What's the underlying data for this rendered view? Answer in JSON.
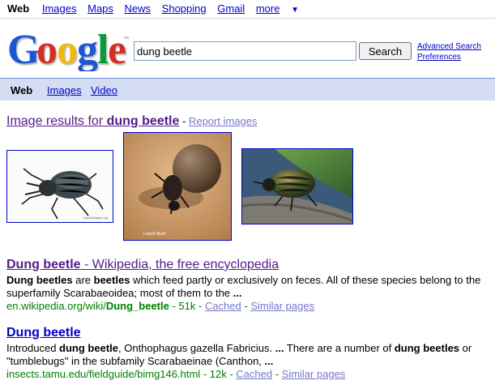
{
  "topnav": {
    "current": "Web",
    "links": [
      "Images",
      "Maps",
      "News",
      "Shopping",
      "Gmail"
    ],
    "more": "more",
    "more_arrow": "▼"
  },
  "logo": {
    "text": "Google",
    "tm": "™"
  },
  "search": {
    "value": "dung beetle",
    "button": "Search",
    "advanced": "Advanced Search",
    "preferences": "Preferences"
  },
  "tabs": {
    "current": "Web",
    "images": "Images",
    "video": "Video"
  },
  "image_results": {
    "prefix": "Image results for ",
    "query": "dung beetle",
    "separator": " - ",
    "report": "Report images",
    "thumb2_caption": "Lowell Shutt"
  },
  "results": [
    {
      "title_bold": "Dung beetle",
      "title_rest": " - Wikipedia, the free encyclopedia",
      "snippet_html": "<b>Dung beetles</b> are <b>beetles</b> which feed partly or exclusively on feces. All of these species belong to the superfamily Scarabaeoidea; most of them to the <b>...</b>",
      "url_plain": "en.wikipedia.org/wiki/",
      "url_bold": "Dung_beetle",
      "size": " - 51k - ",
      "cached": "Cached",
      "similar": "Similar pages"
    },
    {
      "title_bold": "Dung beetle",
      "title_rest": "",
      "snippet_html": "Introduced <b>dung beetle</b>, Onthophagus gazella Fabricius. <b>...</b> There are a number of <b>dung beetles</b> or \"tumblebugs\" in the subfamily Scarabaeinae (Canthon, <b>...</b>",
      "url_plain": "insects.tamu.edu/fieldguide/bimg146.html",
      "url_bold": "",
      "size": " - 12k - ",
      "cached": "Cached",
      "similar": "Similar pages"
    }
  ]
}
